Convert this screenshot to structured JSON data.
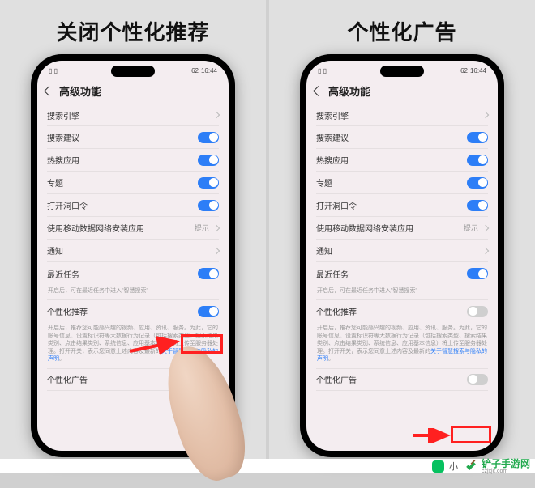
{
  "panels": {
    "left": {
      "title": "关闭个性化推荐",
      "statusTime": "16:44",
      "statusBattery": "62",
      "pageTitle": "高级功能",
      "rows": {
        "r0": {
          "label": "搜索引擎"
        },
        "r1": {
          "label": "搜索建议"
        },
        "r2": {
          "label": "热搜应用"
        },
        "r3": {
          "label": "专题"
        },
        "r4": {
          "label": "打开洞口令"
        },
        "r5": {
          "label": "使用移动数据网络安装应用",
          "hint": "提示"
        },
        "r6": {
          "label": "通知"
        },
        "r7": {
          "label": "最近任务"
        },
        "r7sub": "开启后，可在最近任务中进入\"智慧搜索\"",
        "r8": {
          "label": "个性化推荐"
        },
        "r8sub_prefix": "开启后，推荐您可能感兴趣的视频、应用、资讯、服务。为此，它的账号信息、设置标识符等大数据行为记录（包括搜索类型、搜索结果类别、点击结果类别、系统信息、应用基本信息）将上传至服务器处理。打开开关，表示您同意上述内容及最新的",
        "r8sub_link": "关于智慧搜索与隐私的声明",
        "r8sub_suffix": "。",
        "r9": {
          "label": "个性化广告"
        }
      }
    },
    "right": {
      "title": "个性化广告",
      "statusTime": "16:44",
      "statusBattery": "62",
      "pageTitle": "高级功能",
      "rows": {
        "r0": {
          "label": "搜索引擎"
        },
        "r1": {
          "label": "搜索建议"
        },
        "r2": {
          "label": "热搜应用"
        },
        "r3": {
          "label": "专题"
        },
        "r4": {
          "label": "打开洞口令"
        },
        "r5": {
          "label": "使用移动数据网络安装应用",
          "hint": "提示"
        },
        "r6": {
          "label": "通知"
        },
        "r7": {
          "label": "最近任务"
        },
        "r7sub": "开启后，可在最近任务中进入\"智慧搜索\"",
        "r8": {
          "label": "个性化推荐"
        },
        "r8sub_prefix": "开启后，推荐您可能感兴趣的视频、应用、资讯、服务。为此，它的账号信息、设置标识符等大数据行为记录（包括搜索类型、搜索结果类别、点击结果类别、系统信息、应用基本信息）将上传至服务器处理。打开开关，表示您同意上述内容及最新的",
        "r8sub_link": "关于智慧搜索与隐私的声明",
        "r8sub_suffix": "。",
        "r9": {
          "label": "个性化广告"
        }
      }
    }
  },
  "footer": {
    "wechatText": "小",
    "brand": "铲子手游网",
    "brandUrl": "czjxjc.com"
  }
}
